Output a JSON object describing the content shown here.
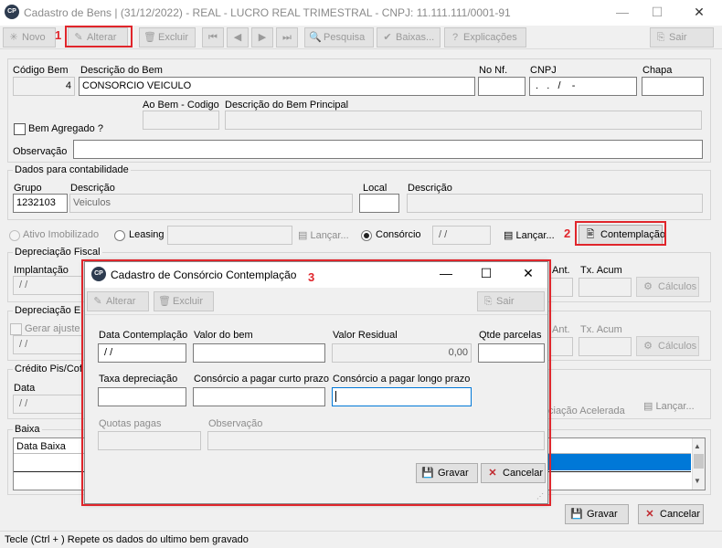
{
  "window": {
    "title": "Cadastro de Bens | (31/12/2022) - REAL - LUCRO REAL TRIMESTRAL  - CNPJ: 11.111.111/0001-91",
    "icon_text": "CP",
    "minimize": "—",
    "maximize": "☐",
    "close": "✕"
  },
  "toolbar": {
    "novo": "Novo",
    "alterar": "Alterar",
    "excluir": "Excluir",
    "first": "⏮",
    "prev": "◀",
    "next": "▶",
    "last": "⏭",
    "pesquisa": "Pesquisa",
    "baixas": "Baixas...",
    "explicacoes": "Explicações",
    "sair": "Sair"
  },
  "annotations": {
    "n1": "1",
    "n2": "2",
    "n3": "3"
  },
  "form": {
    "codigo_label": "Código Bem",
    "codigo_value": "4",
    "descricao_label": "Descrição do Bem",
    "descricao_value": "CONSORCIO VEICULO",
    "nonf_label": "No Nf.",
    "nonf_value": "",
    "cnpj_label": "CNPJ",
    "cnpj_value": " .   .   /    -",
    "chapa_label": "Chapa",
    "chapa_value": "",
    "ao_bem_label": "Ao Bem - Codigo",
    "desc_principal_label": "Descrição do Bem Principal",
    "bem_agregado_label": "Bem Agregado ?",
    "observacao_label": "Observação",
    "observacao_value": ""
  },
  "contabilidade": {
    "title": "Dados para contabilidade",
    "grupo_label": "Grupo",
    "grupo_value": "1232103",
    "descricao_label": "Descrição",
    "descricao_value": "Veiculos",
    "local_label": "Local",
    "local_value": "",
    "local_desc_label": "Descrição"
  },
  "tipo": {
    "ativo_label": "Ativo Imobilizado",
    "leasing_label": "Leasing",
    "lancar1": "Lançar...",
    "consorcio_label": "Consórcio",
    "consorcio_date": " / /",
    "lancar2": "Lançar...",
    "contemplacao": "Contemplação"
  },
  "background_sections": {
    "depreciacao_fiscal": "Depreciação Fiscal",
    "implantacao": "Implantação",
    "implantacao_value": " / /",
    "ant1": "Ant.",
    "tx_acum1": "Tx. Acum",
    "calculos1": "Cálculos",
    "depreciacao_e": "Depreciação E",
    "gerar_ajuste": "Gerar ajuste",
    "gerar_value": " / /",
    "ant2": "Ant.",
    "tx_acum2": "Tx. Acum",
    "calculos2": "Cálculos",
    "credito": "Crédito Pis/Cof",
    "data_label": "Data",
    "data_value": " / /",
    "acelerada": "ciação Acelerada",
    "lancar3": "Lançar...",
    "baixa": "Baixa",
    "data_baixa": "Data Baixa"
  },
  "footer": {
    "gravar": "Gravar",
    "cancelar": "Cancelar",
    "status": "Tecle (Ctrl + ) Repete os dados do ultimo bem gravado"
  },
  "dialog": {
    "title": "Cadastro de Consórcio Contemplação",
    "alterar": "Alterar",
    "excluir": "Excluir",
    "sair": "Sair",
    "data_label": "Data Contemplação",
    "data_value": " / /",
    "valor_label": "Valor do bem",
    "valor_value": "",
    "residual_label": "Valor Residual",
    "residual_value": "0,00",
    "parcelas_label": "Qtde parcelas",
    "parcelas_value": "",
    "taxa_label": "Taxa depreciação",
    "taxa_value": "",
    "curto_label": "Consórcio a pagar curto prazo",
    "curto_value": "",
    "longo_label": "Consórcio a pagar longo prazo",
    "longo_value": "",
    "quotas_label": "Quotas pagas",
    "quotas_value": "",
    "obs_label": "Observação",
    "obs_value": "",
    "gravar": "Gravar",
    "cancelar": "Cancelar"
  },
  "colors": {
    "annotation": "#e0252b",
    "selection": "#0078d7"
  }
}
